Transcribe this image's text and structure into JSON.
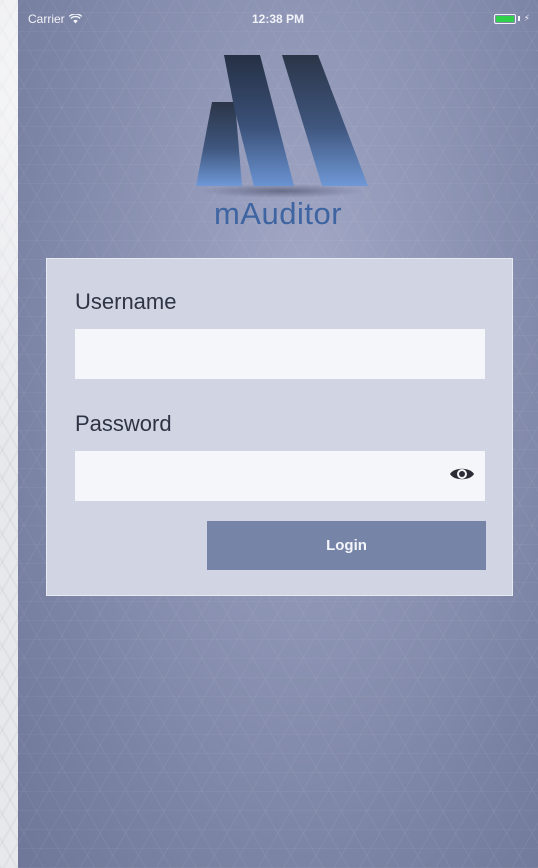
{
  "status_bar": {
    "carrier": "Carrier",
    "time": "12:38 PM",
    "icons": [
      "wifi-icon",
      "battery-icon",
      "charging-icon"
    ],
    "battery_color": "#2fd14b"
  },
  "brand": {
    "app_name": "mAuditor",
    "logo_icon": "m-logo-icon",
    "brand_color": "#3e64a1"
  },
  "login_form": {
    "username_label": "Username",
    "username_value": "",
    "password_label": "Password",
    "password_value": "",
    "password_toggle_icon": "eye-icon",
    "login_label": "Login",
    "button_color": "#7684a8"
  }
}
